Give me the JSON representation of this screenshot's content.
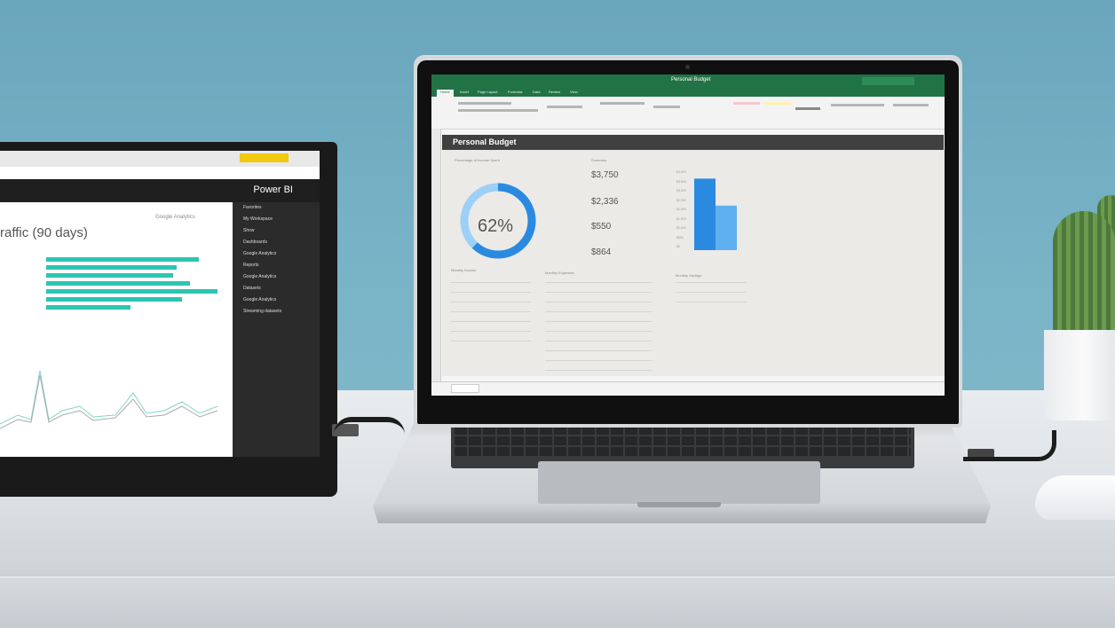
{
  "monitor": {
    "app_name": "Power BI",
    "report_title": "raffic (90 days)",
    "source_label": "Google Analytics",
    "sidebar_items": [
      "Favorites",
      "My Workspace",
      "Show",
      "Dashboards",
      "Google Analytics",
      "Reports",
      "Google Analytics",
      "Datasets",
      "Google Analytics",
      "Streaming datasets"
    ],
    "bar_values": [
      0.82,
      0.7,
      0.68,
      0.77,
      0.92,
      0.73,
      0.45
    ]
  },
  "laptop": {
    "window_title": "Personal Budget",
    "ribbon_tabs": [
      "Home",
      "Insert",
      "Page Layout",
      "Formulas",
      "Data",
      "Review",
      "View"
    ],
    "sheet_title": "Personal Budget",
    "donut": {
      "label": "Percentage of Income Spent",
      "percent_text": "62%",
      "fraction": 0.62
    },
    "summary": {
      "title": "Summary",
      "values": [
        "$3,750",
        "$2,336",
        "$550",
        "$864"
      ]
    },
    "bar_chart": {
      "values": [
        3750,
        2336
      ],
      "ticks": [
        "$4,000",
        "$3,500",
        "$3,000",
        "$2,500",
        "$2,000",
        "$1,500",
        "$1,000",
        "$500",
        "$0"
      ]
    },
    "tables": [
      "Monthly Income",
      "Monthly Expenses",
      "Monthly Savings"
    ]
  },
  "colors": {
    "excel_green": "#217346",
    "donut_blue": "#2a8ae0",
    "bar_blue": "#2a8ae0",
    "bar_light": "#5fb0f0",
    "pb_teal": "#2ec4b0",
    "pb_yellow": "#f2c811"
  }
}
